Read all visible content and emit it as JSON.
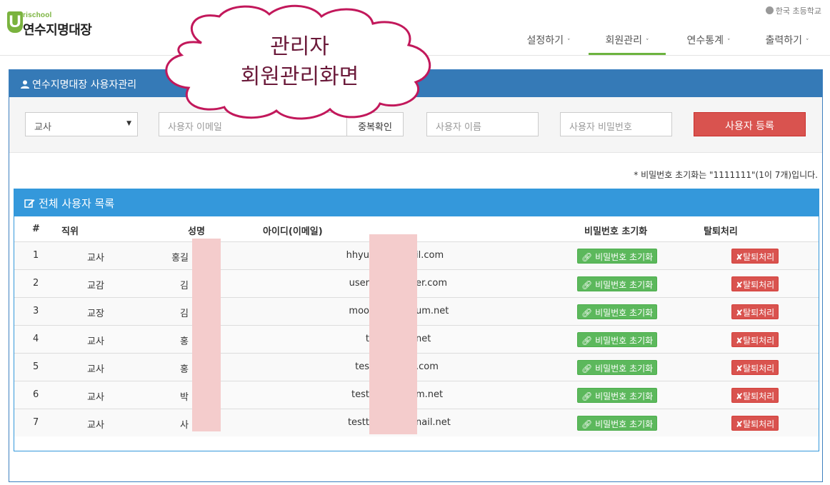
{
  "header": {
    "logo_letter": "U",
    "logo_sub": "rischool",
    "logo_main": "연수지명대장",
    "school_name": "한국 초등학교",
    "nav": [
      {
        "label": "설정하기",
        "active": false
      },
      {
        "label": "회원관리",
        "active": true
      },
      {
        "label": "연수통계",
        "active": false
      },
      {
        "label": "출력하기",
        "active": false
      }
    ]
  },
  "annotation": {
    "line1": "관리자",
    "line2": "회원관리화면"
  },
  "panel": {
    "title": "연수지명대장 사용자관리"
  },
  "form": {
    "role_select": "교사",
    "email_placeholder": "사용자 이메일",
    "dup_check": "중복확인",
    "name_placeholder": "사용자 이름",
    "password_placeholder": "사용자 비밀번호",
    "register_button": "사용자 등록"
  },
  "note": "* 비밀번호 초기화는 \"1111111\"(1이 7개)입니다.",
  "list": {
    "title": "전체 사용자 목록",
    "columns": [
      "#",
      "직위",
      "성명",
      "아이디(이메일)",
      "비밀번호 초기화",
      "탈퇴처리"
    ],
    "reset_label": "비밀번호 초기화",
    "delete_label": "탈퇴처리",
    "rows": [
      {
        "num": "1",
        "role": "교사",
        "name": "홍길",
        "email_left": "hhyu",
        "email_right": "il.com"
      },
      {
        "num": "2",
        "role": "교감",
        "name": "김",
        "email_left": "user",
        "email_right": "er.com"
      },
      {
        "num": "3",
        "role": "교장",
        "name": "김",
        "email_left": "moo",
        "email_right": "um.net"
      },
      {
        "num": "4",
        "role": "교사",
        "name": "홍",
        "email_left": "t",
        "email_right": "net"
      },
      {
        "num": "5",
        "role": "교사",
        "name": "홍",
        "email_left": "tes",
        "email_right": ".com"
      },
      {
        "num": "6",
        "role": "교사",
        "name": "박",
        "email_left": "test",
        "email_right": "m.net"
      },
      {
        "num": "7",
        "role": "교사",
        "name": "사",
        "email_left": "testt",
        "email_right": "nail.net"
      }
    ]
  },
  "colors": {
    "nav_active_underline": "#6cb33f",
    "panel_header": "#357ab7",
    "list_header": "#3498db",
    "register_button": "#d9534f",
    "reset_button": "#5cb85c",
    "delete_button": "#d9534f",
    "annotation_text": "#6b1a3a",
    "cloud_border": "#c2185b"
  }
}
